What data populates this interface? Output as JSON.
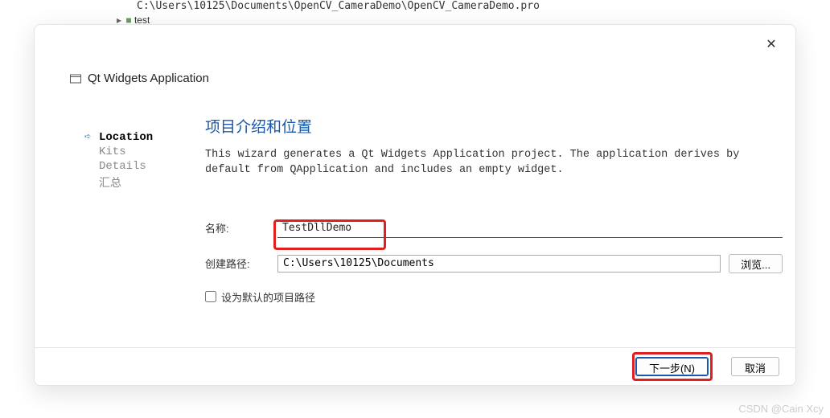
{
  "background": {
    "path": "C:\\Users\\10125\\Documents\\OpenCV_CameraDemo\\OpenCV_CameraDemo.pro",
    "tree_item": "test"
  },
  "dialog": {
    "title": "Qt Widgets Application",
    "close": "✕"
  },
  "sidebar": {
    "items": [
      {
        "label": "Location",
        "active": true
      },
      {
        "label": "Kits",
        "active": false
      },
      {
        "label": "Details",
        "active": false
      },
      {
        "label": "汇总",
        "active": false
      }
    ]
  },
  "main": {
    "heading": "项目介绍和位置",
    "description": "This wizard generates a Qt Widgets Application project. The application derives by default from QApplication and includes an empty widget.",
    "name_label": "名称:",
    "name_value": "TestDllDemo",
    "path_label": "创建路径:",
    "path_value": "C:\\Users\\10125\\Documents",
    "browse_label": "浏览...",
    "default_path_label": "设为默认的项目路径"
  },
  "buttons": {
    "next": "下一步(N)",
    "cancel": "取消"
  },
  "watermark": "CSDN @Cain Xcy"
}
